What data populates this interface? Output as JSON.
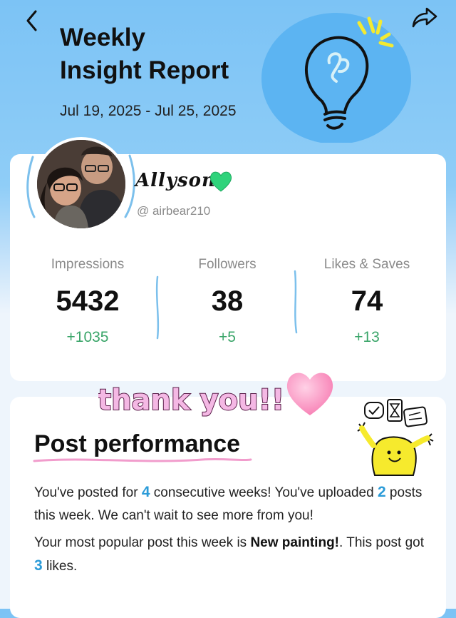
{
  "header": {
    "title_line1": "Weekly",
    "title_line2": "Insight Report",
    "date_range": "Jul 19, 2025 - Jul 25, 2025"
  },
  "profile": {
    "name": "Allyson",
    "handle": "@ airbear210"
  },
  "stats": [
    {
      "label": "Impressions",
      "value": "5432",
      "delta": "+1035"
    },
    {
      "label": "Followers",
      "value": "38",
      "delta": "+5"
    },
    {
      "label": "Likes & Saves",
      "value": "74",
      "delta": "+13"
    }
  ],
  "sticker_text": "thank you!!",
  "post_performance": {
    "title": "Post performance",
    "p1_a": "You've posted for ",
    "weeks": "4",
    "p1_b": " consecutive weeks! You've uploaded ",
    "posts": "2",
    "p1_c": " posts this week. We can't wait to see more from you!",
    "p2_a": "Your most popular post this week is ",
    "post_name": "New painting!",
    "p2_b": ". This post got ",
    "likes": "3",
    "p2_c": " likes."
  },
  "colors": {
    "accent_blue": "#2b9bd8",
    "delta_green": "#3aa569",
    "header_blue": "#7cc3f5",
    "sticker_pink": "#e88fcf"
  },
  "icons": [
    "back-arrow-icon",
    "share-icon",
    "lightbulb-icon",
    "green-heart-icon",
    "pink-heart-icon"
  ]
}
